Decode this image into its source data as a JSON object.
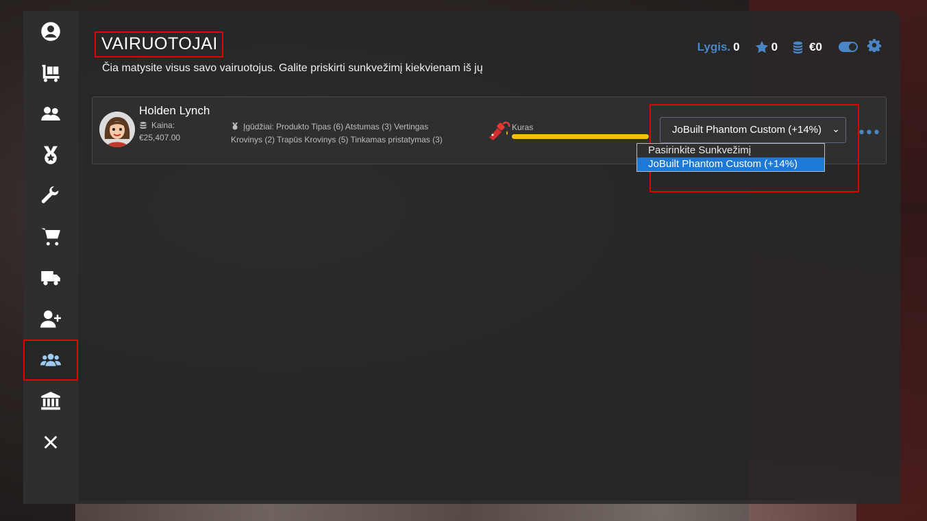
{
  "page": {
    "title": "VAIRUOTOJAI",
    "subtitle": "Čia matysite visus savo vairuotojus. Galite priskirti sunkvežimį kiekvienam iš jų"
  },
  "stats": {
    "level_label": "Lygis.",
    "level_value": "0",
    "stars_value": "0",
    "money_value": "€0"
  },
  "sidebar": {
    "items": [
      {
        "name": "profile",
        "icon": "user-circle-icon"
      },
      {
        "name": "cargo",
        "icon": "dolly-icon"
      },
      {
        "name": "users",
        "icon": "users-icon"
      },
      {
        "name": "awards",
        "icon": "medal-icon"
      },
      {
        "name": "garage",
        "icon": "wrench-icon"
      },
      {
        "name": "shop",
        "icon": "cart-icon"
      },
      {
        "name": "trucks",
        "icon": "truck-icon"
      },
      {
        "name": "hire",
        "icon": "user-plus-icon"
      },
      {
        "name": "drivers",
        "icon": "users-group-icon",
        "active": true
      },
      {
        "name": "bank",
        "icon": "bank-icon"
      },
      {
        "name": "close",
        "icon": "close-icon"
      }
    ]
  },
  "driver": {
    "name": "Holden Lynch",
    "price_label": "Kaina:",
    "price_value": "€25,407.00",
    "skills_text": "Įgūdžiai: Produkto Tipas (6) Atstumas (3) Vertingas Krovinys (2) Trapūs Krovinys (5) Tinkamas pristatymas (3)",
    "fuel_label": "Kuras",
    "fuel_fraction": 1.0,
    "fuel_color": "#f4c20d",
    "selected_truck": "JoBuilt Phantom Custom (+14%)",
    "dropdown_options": [
      "Pasirinkite Sunkvežimį",
      "JoBuilt Phantom Custom (+14%)"
    ],
    "more_icon": "ellipsis-icon"
  }
}
